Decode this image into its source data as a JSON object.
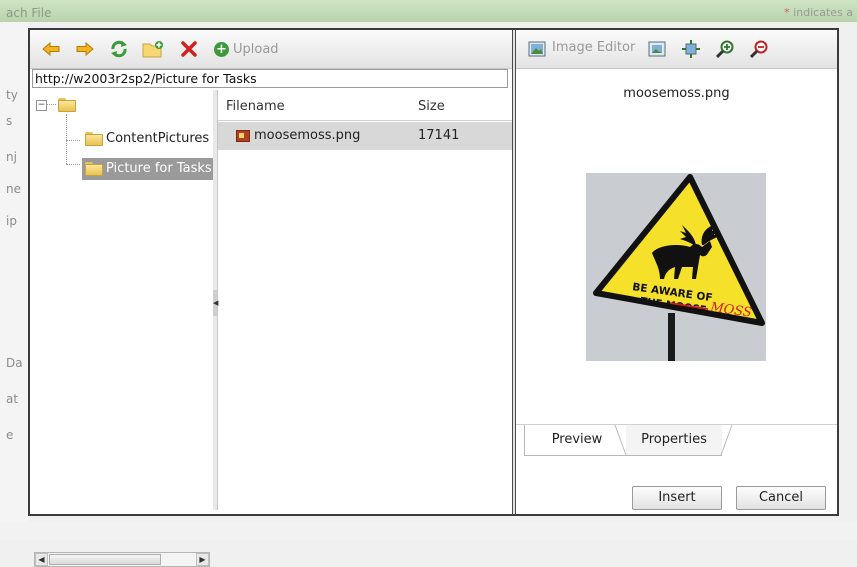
{
  "background": {
    "title": "ach File",
    "note": "indicates a",
    "note_star": "*",
    "labels": [
      "ty",
      "s",
      "nj",
      "ne",
      "ip",
      "Da",
      "at",
      "e"
    ]
  },
  "toolbar": {
    "icons": [
      "back-arrow-icon",
      "forward-arrow-icon",
      "refresh-icon",
      "new-folder-icon",
      "delete-icon"
    ],
    "upload_label": "Upload"
  },
  "path": {
    "value": "http://w2003r2sp2/Picture for Tasks"
  },
  "tree": {
    "root_toggle": "−",
    "items": [
      {
        "label": "ContentPictures",
        "selected": false
      },
      {
        "label": "Picture for Tasks",
        "selected": true
      }
    ]
  },
  "files": {
    "columns": {
      "filename": "Filename",
      "size": "Size"
    },
    "rows": [
      {
        "name": "moosemoss.png",
        "size": "17141"
      }
    ]
  },
  "right_toolbar": {
    "image_editor_label": "Image Editor",
    "icons": [
      "image-editor-icon",
      "fit-image-icon",
      "actual-size-icon",
      "zoom-in-icon",
      "zoom-out-icon"
    ]
  },
  "preview": {
    "filename": "moosemoss.png",
    "sign_line1": "BE AWARE OF",
    "sign_line2": "THE MOOSE",
    "sign_overlay": "MOSS"
  },
  "tabs": {
    "preview": "Preview",
    "properties": "Properties"
  },
  "buttons": {
    "insert": "Insert",
    "cancel": "Cancel"
  },
  "colors": {
    "sign_yellow": "#f5e12a",
    "delete_red": "#d02020",
    "upload_green": "#3c9a3c"
  }
}
